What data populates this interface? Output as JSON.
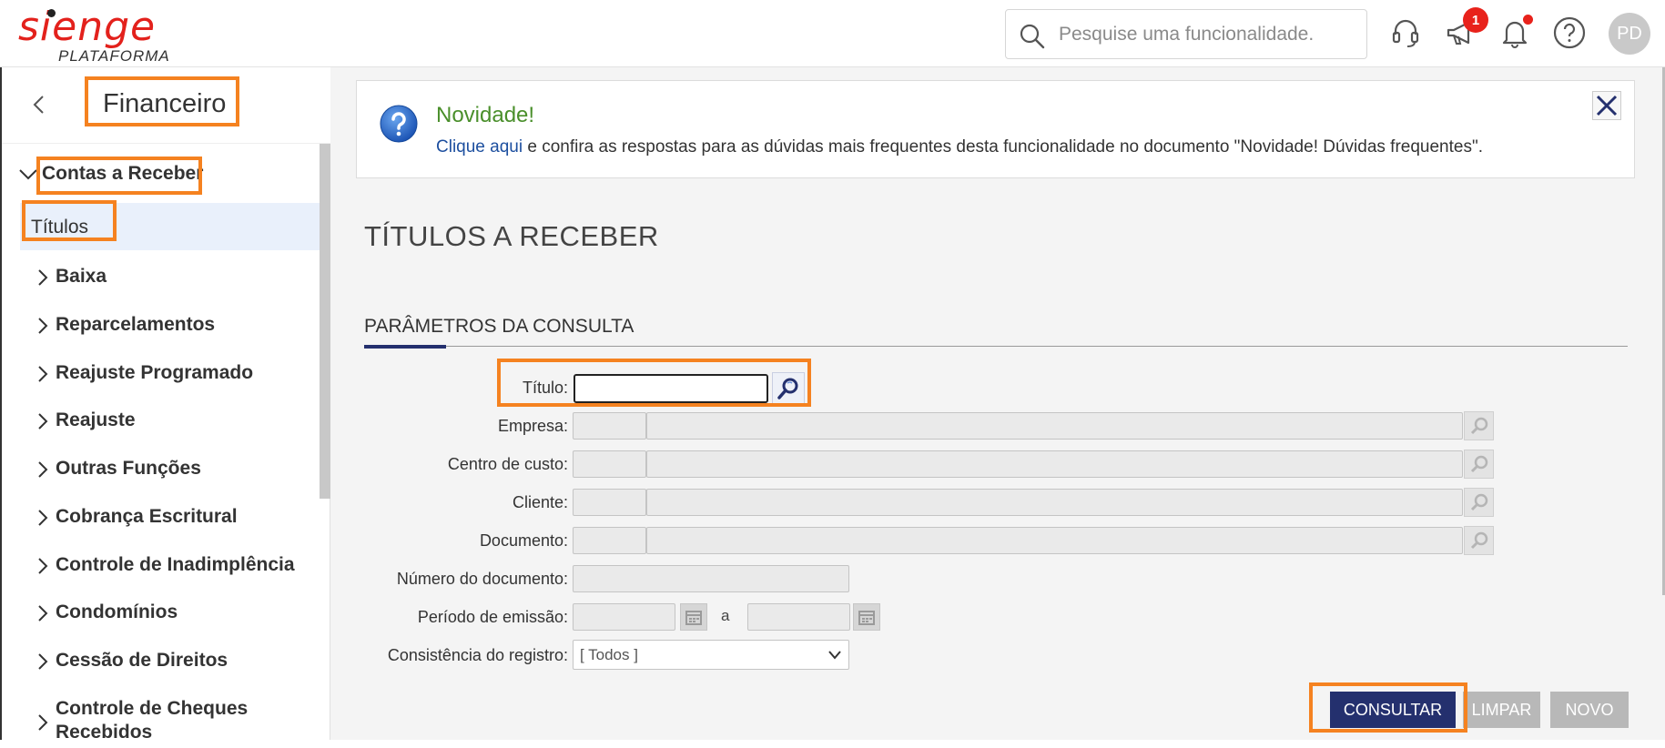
{
  "header": {
    "logo_text": "sienge",
    "logo_sub": "PLATAFORMA",
    "search_placeholder": "Pesquise uma funcionalidade.",
    "notification_badge": "1",
    "avatar_initials": "PD",
    "icons": [
      "headset-icon",
      "megaphone-icon",
      "bell-icon",
      "help-icon"
    ]
  },
  "sidebar": {
    "module_title": "Financeiro",
    "group_label": "Contas a Receber",
    "active_item": "Títulos",
    "items": [
      "Baixa",
      "Reparcelamentos",
      "Reajuste Programado",
      "Reajuste",
      "Outras Funções",
      "Cobrança Escritural",
      "Controle de Inadimplência",
      "Condomínios",
      "Cessão de Direitos",
      "Controle de Cheques Recebidos"
    ]
  },
  "notice": {
    "title": "Novidade!",
    "link_text": "Clique aqui",
    "text": " e confira as respostas para as dúvidas mais frequentes desta funcionalidade no documento \"Novidade! Dúvidas frequentes\"."
  },
  "main": {
    "page_title": "TÍTULOS A RECEBER",
    "section_title": "PARÂMETROS DA CONSULTA",
    "fields": {
      "titulo": "Título:",
      "empresa": "Empresa:",
      "centro_custo": "Centro de custo:",
      "cliente": "Cliente:",
      "documento": "Documento:",
      "numero_documento": "Número do documento:",
      "periodo_emissao": "Período de emissão:",
      "periodo_sep": "a",
      "consistencia": "Consistência do registro:"
    },
    "consistencia_value": "[ Todos ]",
    "buttons": {
      "consultar": "CONSULTAR",
      "limpar": "LIMPAR",
      "novo": "NOVO"
    }
  },
  "colors": {
    "brand_red": "#e3211c",
    "highlight_orange": "#f58220",
    "primary_navy": "#24306e",
    "notice_green": "#4a8f2b",
    "link_blue": "#1d4f9f"
  }
}
